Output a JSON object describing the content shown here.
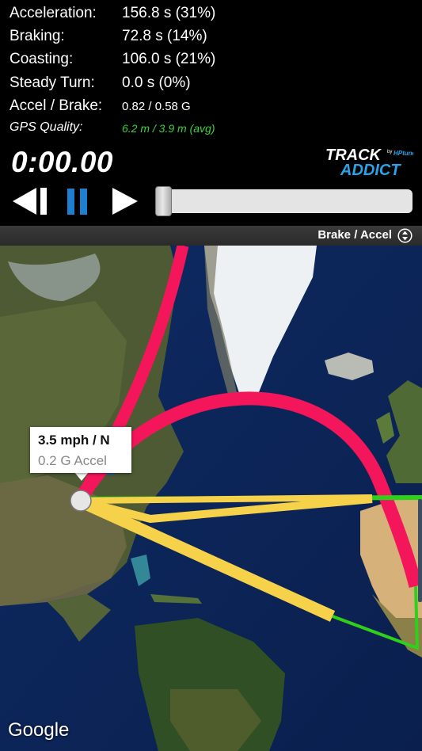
{
  "stats": {
    "acceleration": {
      "label": "Acceleration:",
      "value": "156.8 s (31%)"
    },
    "braking": {
      "label": "Braking:",
      "value": "72.8 s (14%)"
    },
    "coasting": {
      "label": "Coasting:",
      "value": "106.0 s (21%)"
    },
    "steady_turn": {
      "label": "Steady Turn:",
      "value": "0.0 s (0%)"
    },
    "accel_brake": {
      "label": "Accel / Brake:",
      "value": "0.82 / 0.58 G"
    },
    "gps_quality": {
      "label": "GPS Quality:",
      "value": "6.2 m / 3.9 m (avg)",
      "color": "#3bd23b"
    }
  },
  "playback": {
    "timer": "0:00.00",
    "position_fraction": 0.0,
    "icons": [
      "skip-back-icon",
      "pause-icon",
      "play-icon"
    ],
    "pause_color": "#1e7fd0"
  },
  "logo": {
    "line1": "TRACK",
    "line2": "ADDICT",
    "by": "by",
    "brand": "HPtuners"
  },
  "mode": {
    "label": "Brake / Accel",
    "icon": "dropdown-diamond-icon"
  },
  "map": {
    "callout": {
      "speed": "3.5 mph / N",
      "accel": "0.2 G Accel"
    },
    "attribution": "Google",
    "track_colors": {
      "braking": "#f4165a",
      "coasting": "#f6d24a",
      "accel": "#2ed019"
    }
  }
}
